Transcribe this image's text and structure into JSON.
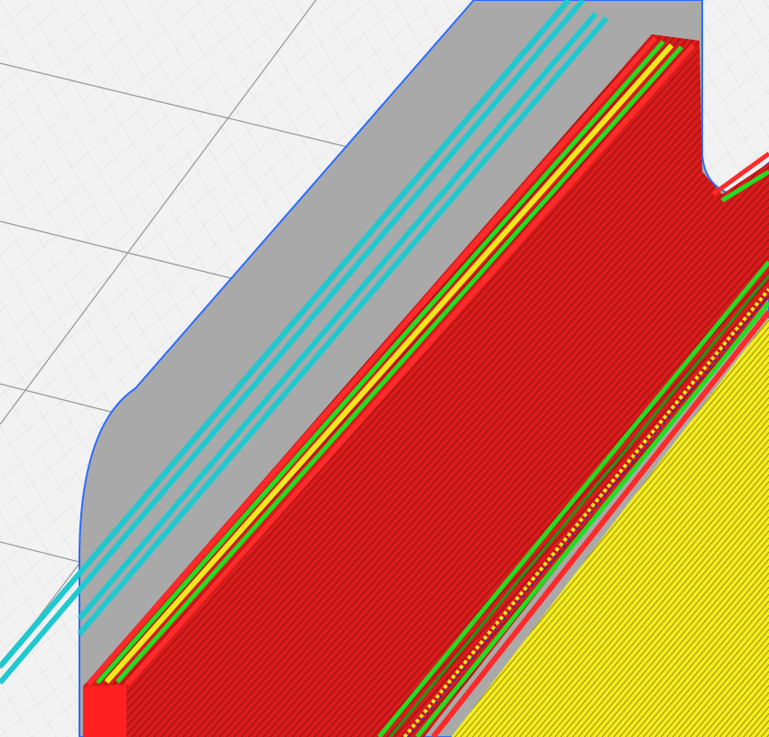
{
  "viewport": {
    "view": "gcode-preview-3d",
    "colors": {
      "background": "#f2f2f2",
      "grid_minor": "#dcdcdc",
      "grid_major": "#9a9a9a",
      "skirt_fill": "#a9a9a9",
      "skirt_outline": "#2a6cff",
      "skirt_lines": "#20c8d0",
      "perimeter": "#e01e1e",
      "external_perimeter": "#ff2a2a",
      "inner_perimeter": "#22dd22",
      "infill": "#f2e81e",
      "seam": "#2233cc"
    }
  }
}
